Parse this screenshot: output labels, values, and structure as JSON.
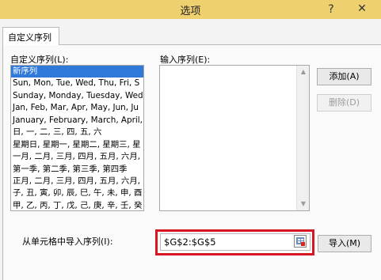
{
  "window": {
    "title": "选项",
    "help": "?",
    "close": "✕"
  },
  "tab": {
    "label": "自定义序列"
  },
  "custom_lists": {
    "label": "自定义序列(L):",
    "items": [
      "新序列",
      "Sun, Mon, Tue, Wed, Thu, Fri, S",
      "Sunday, Monday, Tuesday, Wed",
      "Jan, Feb, Mar, Apr, May, Jun, Ju",
      "January, February, March, April,",
      "日, 一, 二, 三, 四, 五, 六",
      "星期日, 星期一, 星期二, 星期三, 星",
      "一月, 二月, 三月, 四月, 五月, 六月,",
      "第一季, 第二季, 第三季, 第四季",
      "正月, 二月, 三月, 四月, 五月, 六月,",
      "子, 丑, 寅, 卯, 辰, 巳, 午, 未, 申, 酉",
      "甲, 乙, 丙, 丁, 戊, 己, 庚, 辛, 壬, 癸"
    ],
    "selected_index": 0
  },
  "input_list": {
    "label": "输入序列(E):",
    "value": ""
  },
  "buttons": {
    "add": "添加(A)",
    "delete": "删除(D)",
    "import": "导入(M)"
  },
  "import_range": {
    "label": "从单元格中导入序列(I):",
    "value": "$G$2:$G$5"
  },
  "colors": {
    "titlebar": "#efd06f",
    "selection": "#2f79d9",
    "highlight": "#d81622"
  }
}
